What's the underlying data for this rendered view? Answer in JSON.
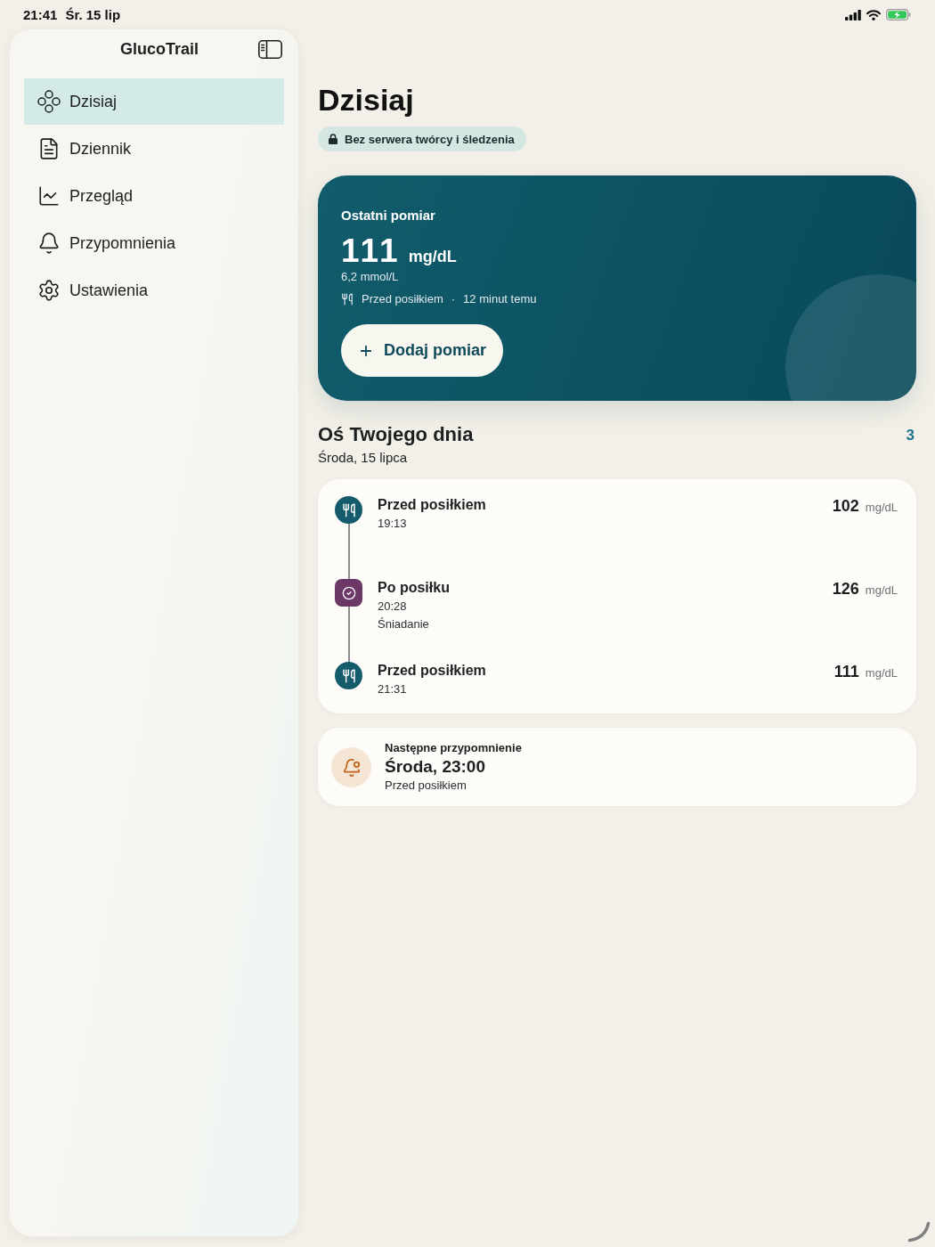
{
  "status_bar": {
    "time": "21:41",
    "date": "Śr. 15 lip"
  },
  "sidebar": {
    "title": "GlucoTrail",
    "items": [
      {
        "kind": "today",
        "label": "Dzisiaj",
        "selected": true
      },
      {
        "kind": "journal",
        "label": "Dziennik",
        "selected": false
      },
      {
        "kind": "overview",
        "label": "Przegląd",
        "selected": false
      },
      {
        "kind": "reminders",
        "label": "Przypomnienia",
        "selected": false
      },
      {
        "kind": "settings",
        "label": "Ustawienia",
        "selected": false
      }
    ]
  },
  "page": {
    "title": "Dzisiaj",
    "privacy_badge": "Bez serwera twórcy i śledzenia"
  },
  "latest_reading": {
    "label": "Ostatni pomiar",
    "value": "111",
    "unit": "mg/dL",
    "converted": "6,2 mmol/L",
    "context": "Przed posiłkiem",
    "separator": "·",
    "time_ago": "12 minut temu",
    "button": "Dodaj pomiar"
  },
  "timeline": {
    "title": "Oś Twojego dnia",
    "date": "Środa, 15 lipca",
    "count": "3",
    "entries": [
      {
        "kind": "premeal",
        "title": "Przed posiłkiem",
        "time": "19:13",
        "value": "102",
        "unit": "mg/dL"
      },
      {
        "kind": "postmeal",
        "title": "Po posiłku",
        "time": "20:28",
        "note": "Śniadanie",
        "value": "126",
        "unit": "mg/dL"
      },
      {
        "kind": "premeal",
        "title": "Przed posiłkiem",
        "time": "21:31",
        "value": "111",
        "unit": "mg/dL"
      }
    ]
  },
  "next_reminder": {
    "label": "Następne przypomnienie",
    "when": "Środa, 23:00",
    "type": "Przed posiłkiem"
  }
}
